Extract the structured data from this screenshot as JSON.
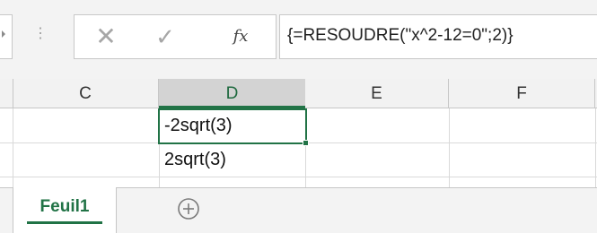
{
  "formula_bar": {
    "cancel_icon": "close-icon",
    "cancel_glyph": "✕",
    "enter_icon": "check-icon",
    "enter_glyph": "✓",
    "function_icon": "insert-function-icon",
    "function_label": "fx",
    "formula": "{=RESOUDRE(\"x^2-12=0\";2)}"
  },
  "columns": [
    "C",
    "D",
    "E",
    "F"
  ],
  "selected_column": "D",
  "cells": {
    "D1": "-2sqrt(3)",
    "D2": "2sqrt(3)"
  },
  "sheet_tabs": {
    "active": "Feuil1",
    "add_icon": "plus-circle-icon"
  },
  "colors": {
    "accent": "#217346",
    "header_bg": "#f2f2f2",
    "selected_header_bg": "#d3d3d3"
  }
}
